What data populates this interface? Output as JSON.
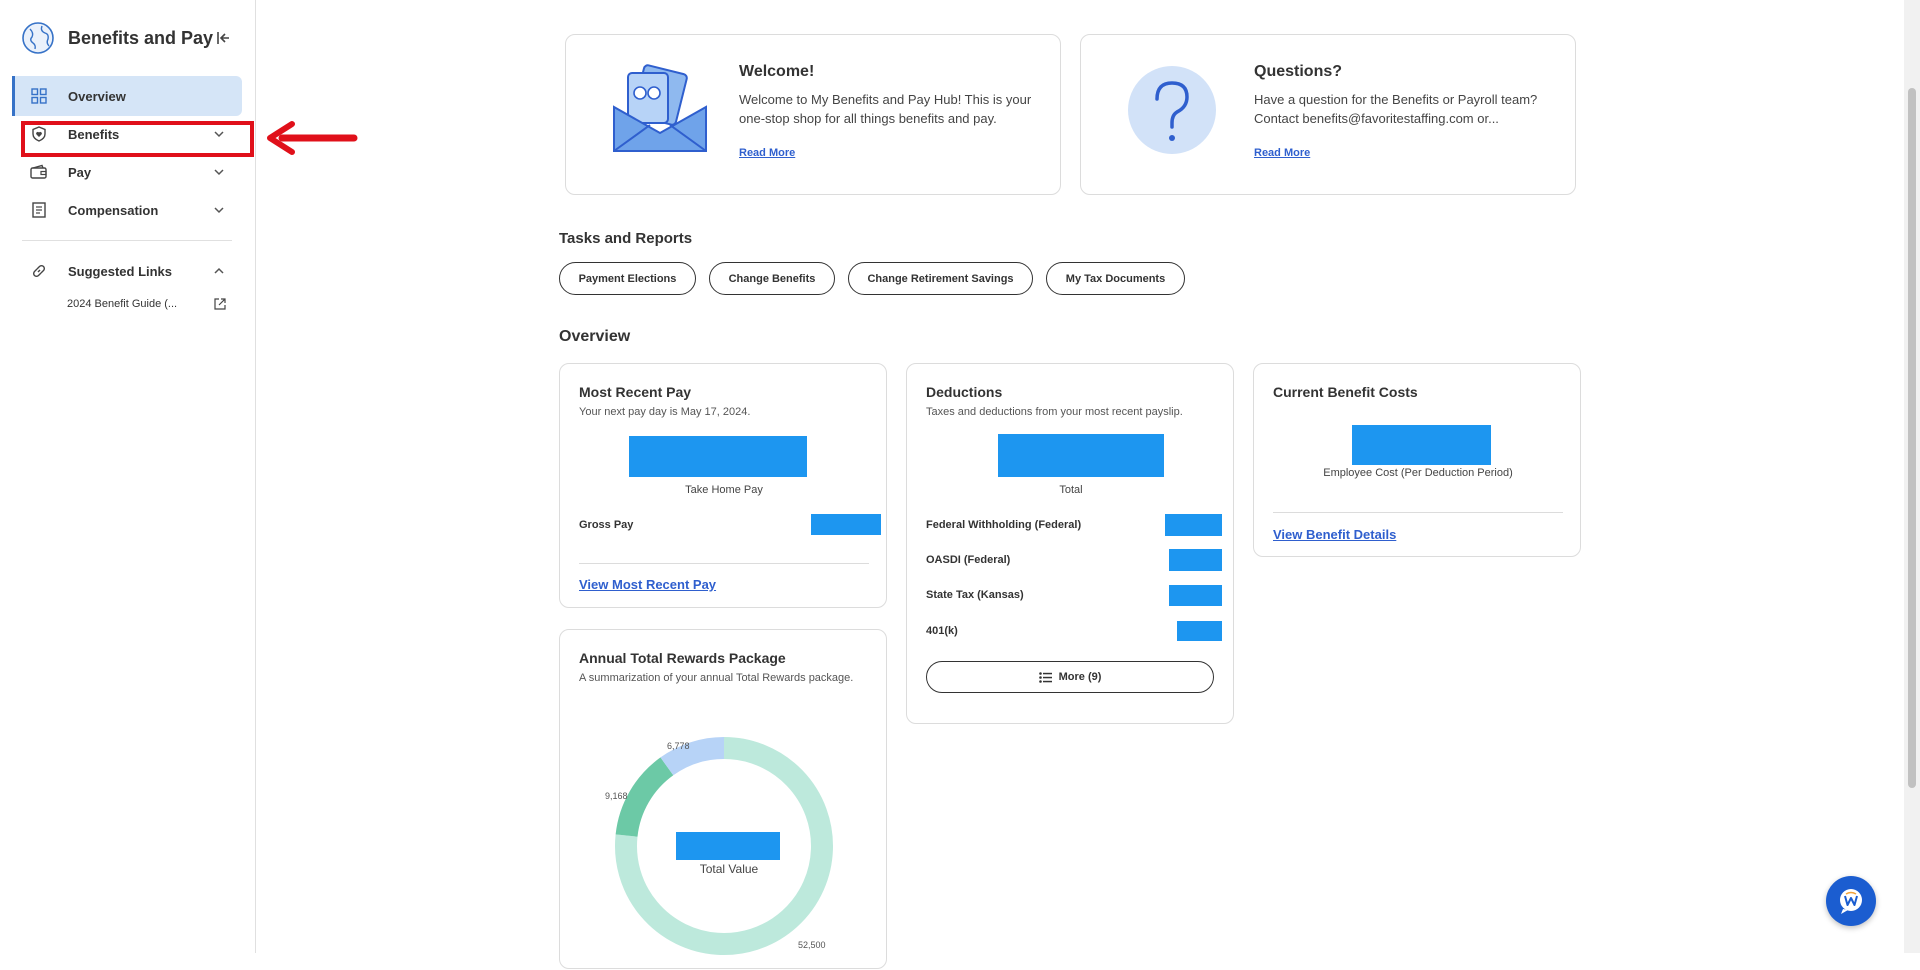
{
  "sidebar": {
    "title": "Benefits and Pay",
    "items": [
      {
        "label": "Overview",
        "icon": "grid-icon",
        "active": true
      },
      {
        "label": "Benefits",
        "icon": "shield-heart-icon"
      },
      {
        "label": "Pay",
        "icon": "wallet-icon"
      },
      {
        "label": "Compensation",
        "icon": "document-icon"
      }
    ],
    "suggested": {
      "label": "Suggested Links",
      "icon": "link-icon",
      "links": [
        {
          "label": "2024 Benefit Guide (..."
        }
      ]
    }
  },
  "welcome": {
    "title": "Welcome!",
    "body": "Welcome to My Benefits and Pay Hub! This is your one-stop shop for all things benefits and pay.",
    "link": "Read More"
  },
  "questions": {
    "title": "Questions?",
    "body": "Have a question for the Benefits or Payroll team? Contact benefits@favoritestaffing.com or...",
    "link": "Read More"
  },
  "tasks": {
    "title": "Tasks and Reports",
    "chips": [
      "Payment Elections",
      "Change Benefits",
      "Change Retirement Savings",
      "My Tax Documents"
    ]
  },
  "overview": {
    "title": "Overview",
    "recent_pay": {
      "title": "Most Recent Pay",
      "subtitle": "Your next pay day is May 17, 2024.",
      "caption": "Take Home Pay",
      "gross_label": "Gross Pay",
      "link": "View Most Recent Pay"
    },
    "deductions": {
      "title": "Deductions",
      "subtitle": "Taxes and deductions from your most recent payslip.",
      "caption": "Total",
      "rows": [
        "Federal Withholding (Federal)",
        "OASDI (Federal)",
        "State Tax (Kansas)",
        "401(k)"
      ],
      "more": "More (9)"
    },
    "benefit_costs": {
      "title": "Current Benefit Costs",
      "caption": "Employee Cost (Per Deduction Period)",
      "link": "View Benefit Details"
    },
    "rewards": {
      "title": "Annual Total Rewards Package",
      "subtitle": "A summarization of your annual Total Rewards package.",
      "center_label": "Total Value",
      "slices": [
        {
          "label": "52,500",
          "value": 52500,
          "color": "#bde9dc"
        },
        {
          "label": "9,168",
          "value": 9168,
          "color": "#6cc9a6"
        },
        {
          "label": "6,778",
          "value": 6778,
          "color": "#b7d3f7"
        }
      ]
    }
  },
  "colors": {
    "accent": "#2f5fce",
    "redacted": "#1d96f0",
    "highlight": "#e0101a"
  }
}
